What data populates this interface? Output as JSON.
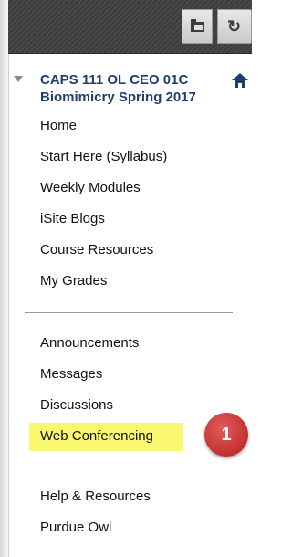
{
  "toolbar": {
    "folder_icon": "folder-icon",
    "refresh_icon": "refresh-icon",
    "refresh_glyph": "↻"
  },
  "course": {
    "title_line1": "CAPS 111 OL CEO 01C",
    "title_line2": "Biomimicry Spring 2017",
    "home_icon": "home-icon"
  },
  "menu": {
    "group1": [
      "Home",
      "Start Here (Syllabus)",
      "Weekly Modules",
      "iSite Blogs",
      "Course Resources",
      "My Grades"
    ],
    "group2": [
      "Announcements",
      "Messages",
      "Discussions",
      "Web Conferencing"
    ],
    "group3": [
      "Help & Resources",
      "Purdue Owl"
    ]
  },
  "annotation": {
    "badge_number": "1",
    "highlight_color": "#fbf870",
    "badge_color": "#c43030"
  },
  "colors": {
    "course_title": "#1f3d70",
    "toolbar_bg": "#3f3f3f"
  }
}
